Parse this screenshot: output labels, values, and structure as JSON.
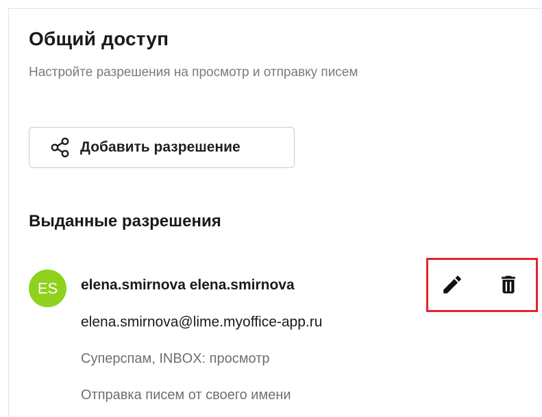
{
  "header": {
    "title": "Общий доступ",
    "subtitle": "Настройте разрешения на просмотр и отправку писем"
  },
  "add_button": {
    "label": "Добавить разрешение",
    "icon": "share-icon"
  },
  "permissions_section": {
    "title": "Выданные разрешения",
    "items": [
      {
        "avatar_initials": "ES",
        "avatar_color": "#8fd11c",
        "name": "elena.smirnova elena.smirnova",
        "email": "elena.smirnova@lime.myoffice-app.ru",
        "permission_1": "Суперспам, INBOX: просмотр",
        "permission_2": "Отправка писем от своего имени",
        "actions": [
          {
            "icon": "pencil-icon"
          },
          {
            "icon": "trash-icon"
          }
        ]
      }
    ]
  },
  "highlight_color": "#e8212b"
}
